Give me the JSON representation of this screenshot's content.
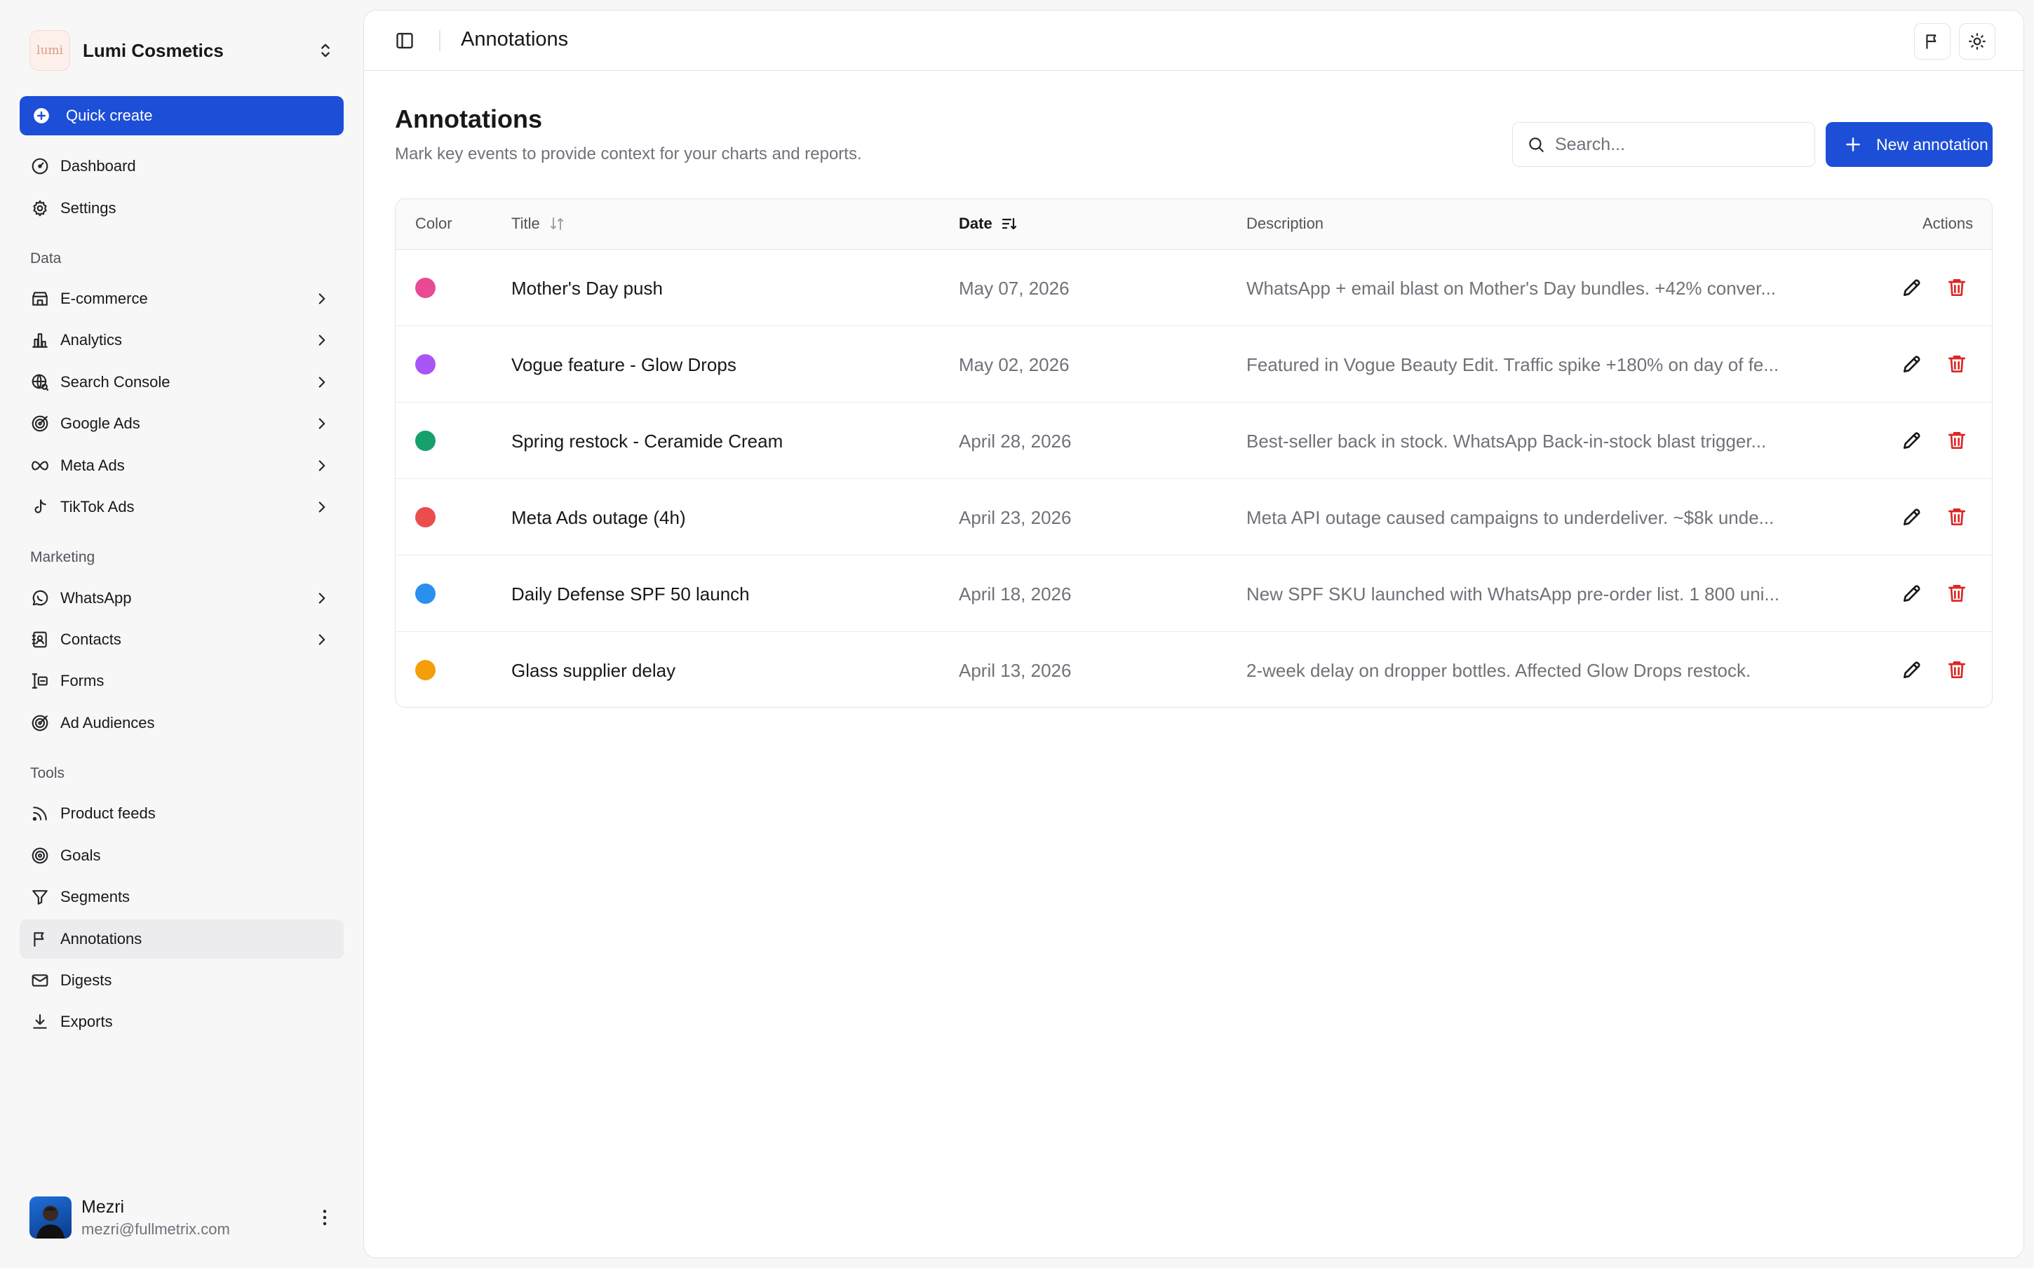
{
  "workspace": {
    "name": "Lumi Cosmetics",
    "logo_text": "lumi"
  },
  "sidebar": {
    "quick_create": "Quick create",
    "items_top": [
      {
        "label": "Dashboard",
        "icon": "gauge-icon"
      },
      {
        "label": "Settings",
        "icon": "gear-icon"
      }
    ],
    "sections": [
      {
        "label": "Data",
        "items": [
          {
            "label": "E-commerce",
            "icon": "store-icon",
            "chevron": true
          },
          {
            "label": "Analytics",
            "icon": "bar-chart-icon",
            "chevron": true
          },
          {
            "label": "Search Console",
            "icon": "globe-search-icon",
            "chevron": true
          },
          {
            "label": "Google Ads",
            "icon": "target-icon",
            "chevron": true
          },
          {
            "label": "Meta Ads",
            "icon": "infinity-icon",
            "chevron": true
          },
          {
            "label": "TikTok Ads",
            "icon": "music-note-icon",
            "chevron": true
          }
        ]
      },
      {
        "label": "Marketing",
        "items": [
          {
            "label": "WhatsApp",
            "icon": "chat-bubble-icon",
            "chevron": true
          },
          {
            "label": "Contacts",
            "icon": "contact-book-icon",
            "chevron": true
          },
          {
            "label": "Forms",
            "icon": "form-icon",
            "chevron": false
          },
          {
            "label": "Ad Audiences",
            "icon": "target-icon",
            "chevron": false
          }
        ]
      },
      {
        "label": "Tools",
        "items": [
          {
            "label": "Product feeds",
            "icon": "rss-icon",
            "chevron": false
          },
          {
            "label": "Goals",
            "icon": "goal-icon",
            "chevron": false
          },
          {
            "label": "Segments",
            "icon": "filter-icon",
            "chevron": false
          },
          {
            "label": "Annotations",
            "icon": "flag-icon",
            "chevron": false,
            "active": true
          },
          {
            "label": "Digests",
            "icon": "mail-icon",
            "chevron": false
          },
          {
            "label": "Exports",
            "icon": "download-icon",
            "chevron": false
          }
        ]
      }
    ]
  },
  "user": {
    "name": "Mezri",
    "email": "mezri@fullmetrix.com"
  },
  "topbar": {
    "title": "Annotations"
  },
  "page": {
    "title": "Annotations",
    "subtitle": "Mark key events to provide context for your charts and reports.",
    "search_placeholder": "Search...",
    "new_button": "New annotation"
  },
  "table": {
    "headers": {
      "color": "Color",
      "title": "Title",
      "date": "Date",
      "description": "Description",
      "actions": "Actions"
    },
    "rows": [
      {
        "color": "#e84a93",
        "title": "Mother's Day push",
        "date": "May 07, 2026",
        "description": "WhatsApp + email blast on Mother's Day bundles. +42% conver..."
      },
      {
        "color": "#a855f7",
        "title": "Vogue feature - Glow Drops",
        "date": "May 02, 2026",
        "description": "Featured in Vogue Beauty Edit. Traffic spike +180% on day of fe..."
      },
      {
        "color": "#16a06b",
        "title": "Spring restock - Ceramide Cream",
        "date": "April 28, 2026",
        "description": "Best-seller back in stock. WhatsApp Back-in-stock blast trigger..."
      },
      {
        "color": "#ea4d4d",
        "title": "Meta Ads outage (4h)",
        "date": "April 23, 2026",
        "description": "Meta API outage caused campaigns to underdeliver. ~$8k unde..."
      },
      {
        "color": "#2b8ff0",
        "title": "Daily Defense SPF 50 launch",
        "date": "April 18, 2026",
        "description": "New SPF SKU launched with WhatsApp pre-order list. 1 800 uni..."
      },
      {
        "color": "#f59e0b",
        "title": "Glass supplier delay",
        "date": "April 13, 2026",
        "description": "2-week delay on dropper bottles. Affected Glow Drops restock."
      }
    ]
  },
  "colors": {
    "primary": "#1d4ed8",
    "danger": "#dc2626"
  }
}
